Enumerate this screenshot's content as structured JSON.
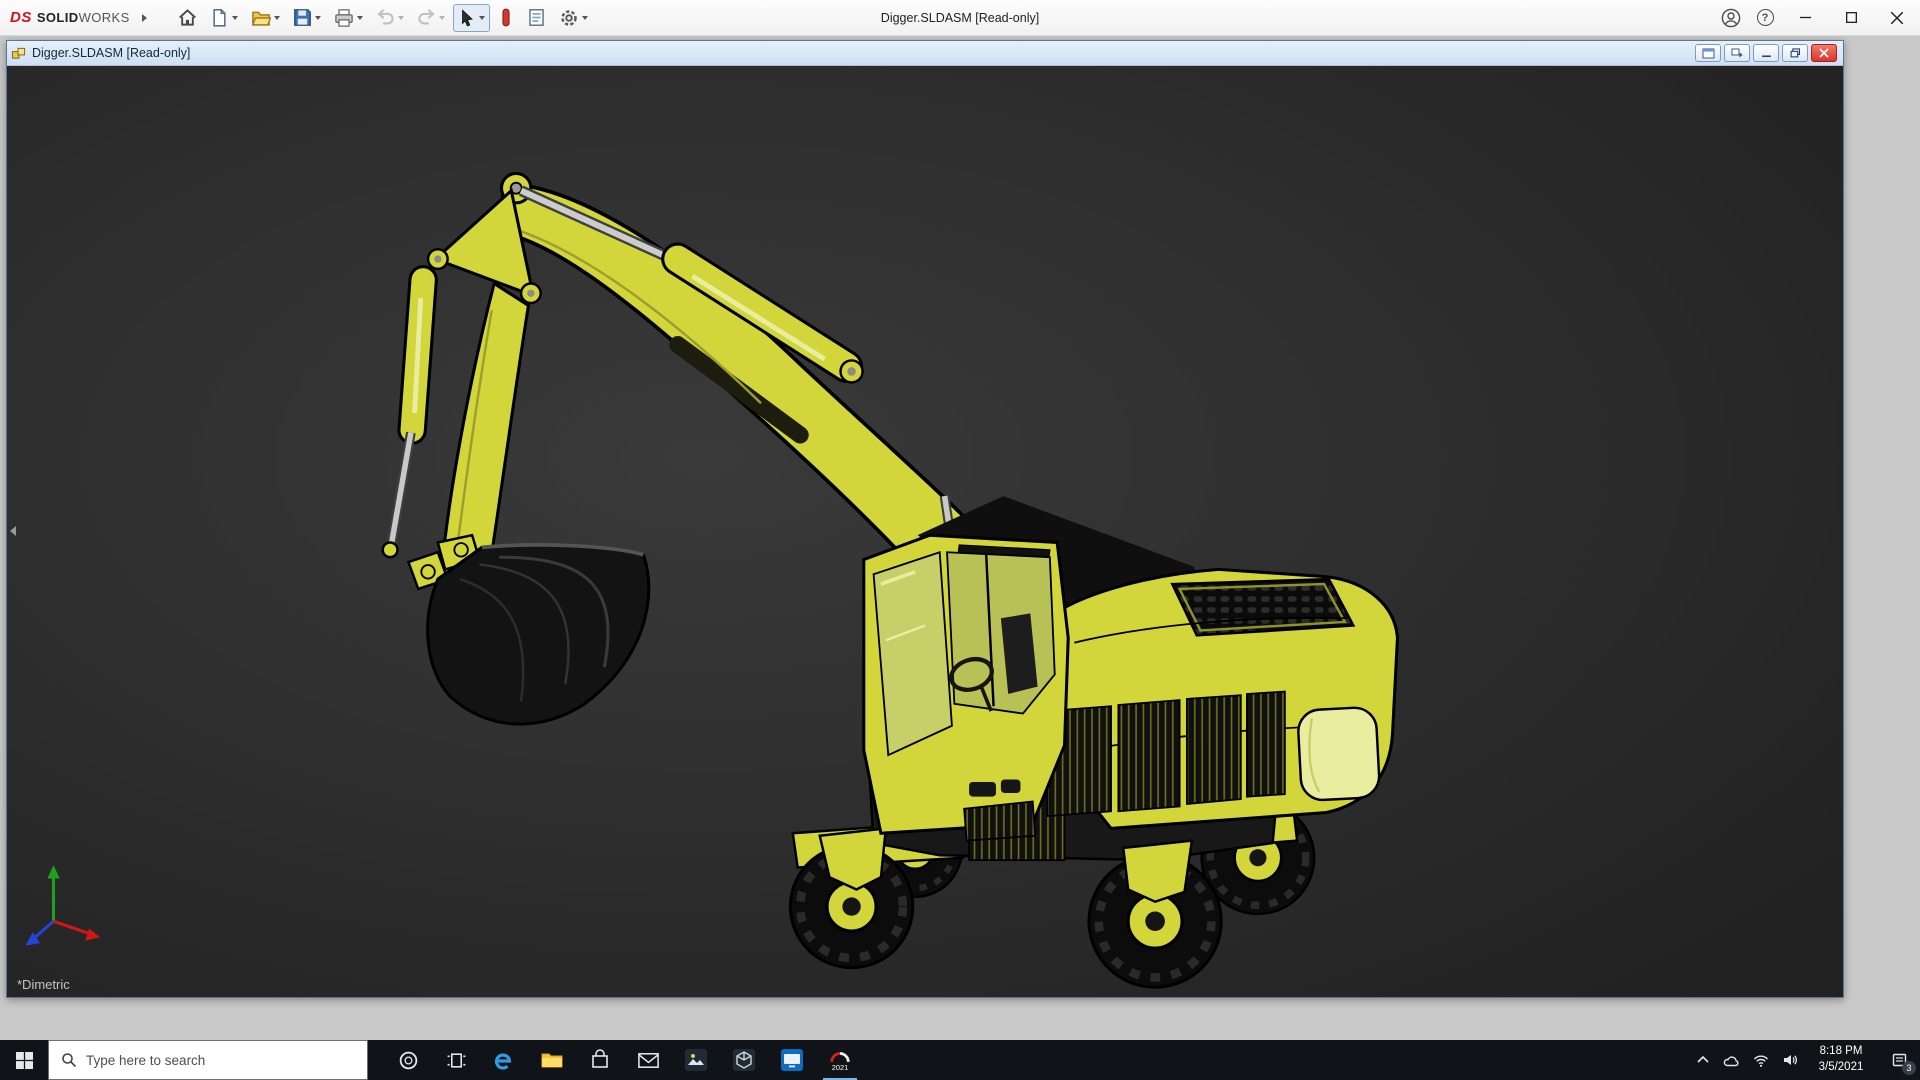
{
  "app": {
    "brand_mark": "DS",
    "brand_bold": "SOLID",
    "brand_light": "WORKS",
    "title": "Digger.SLDASM [Read-only]",
    "help_glyph": "?"
  },
  "toolbar": {
    "buttons": [
      {
        "name": "home"
      },
      {
        "name": "new-document",
        "caret": true
      },
      {
        "name": "open",
        "caret": true
      },
      {
        "name": "save",
        "caret": true
      },
      {
        "name": "print",
        "caret": true
      },
      {
        "name": "undo",
        "caret": true,
        "disabled": true
      },
      {
        "name": "redo",
        "caret": true,
        "disabled": true
      },
      {
        "name": "select",
        "caret": true,
        "active": true
      },
      {
        "name": "rebuild"
      },
      {
        "name": "file-properties"
      },
      {
        "name": "options",
        "caret": true
      }
    ]
  },
  "doc": {
    "title": "Digger.SLDASM [Read-only]",
    "view_orientation": "*Dimetric"
  },
  "taskbar": {
    "search_placeholder": "Type here to search",
    "app_icons": [
      "cortana",
      "task-view",
      "edge",
      "file-explorer",
      "store",
      "mail",
      "photos",
      "3d-viewer",
      "display",
      "solidworks-2021"
    ],
    "solidworks_year": "2021",
    "tray_time": "8:18 PM",
    "tray_date": "3/5/2021",
    "notification_count": "3"
  },
  "colors": {
    "excavator_yellow": "#d2d63a",
    "viewport_bg": "#2b2b2b",
    "taskbar_bg": "#101418",
    "doc_titlebar_from": "#e7f0fa",
    "doc_titlebar_to": "#cfdff2",
    "close_red": "#d8372a",
    "app_bg": "#c9c9c9"
  }
}
